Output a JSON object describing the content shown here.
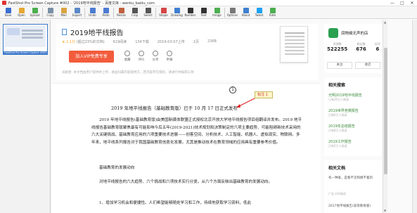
{
  "titlebar": {
    "title": "FastShot Pro Screen Capture #002 - '2019地平线报告' - 百度文库 - wenku_baidu_com",
    "minimize": "—",
    "maximize": "□",
    "close": "✕"
  },
  "toolbar": {
    "items": [
      {
        "label": "Save",
        "icon": "save-icon",
        "color": "#3b6ecf"
      },
      {
        "label": "Open",
        "icon": "open-icon",
        "color": "#e5a832"
      },
      {
        "label": "Upload",
        "icon": "upload-icon",
        "color": "#4caf50"
      },
      {
        "label": "Copy",
        "icon": "copy-icon",
        "color": "#7a8fa6"
      },
      {
        "label": "Mail",
        "icon": "mail-icon",
        "color": "#d9a441"
      },
      {
        "label": "Export",
        "icon": "export-icon",
        "color": "#5a88c8"
      },
      {
        "label": "Undo",
        "icon": "undo-icon",
        "color": "#4b7bd0"
      },
      {
        "label": "Redo",
        "icon": "redo-icon",
        "color": "#4b7bd0"
      },
      {
        "label": "Resize",
        "icon": "resize-icon",
        "color": "#c06040"
      },
      {
        "label": "Crop",
        "icon": "crop-icon",
        "color": "#555555"
      },
      {
        "label": "Select",
        "icon": "select-icon",
        "color": "#555555"
      },
      {
        "label": "Shape",
        "icon": "shape-icon",
        "color": "#d64545"
      },
      {
        "label": "Drawing",
        "icon": "drawing-icon",
        "color": "#3f7fd1"
      },
      {
        "label": "Number",
        "icon": "number-icon",
        "color": "#333333"
      },
      {
        "label": "Text",
        "icon": "text-icon",
        "color": "#333333"
      },
      {
        "label": "Image",
        "icon": "image-icon",
        "color": "#4caf50"
      },
      {
        "label": "Options",
        "icon": "options-icon",
        "color": "#777777"
      },
      {
        "label": "About",
        "icon": "about-icon",
        "color": "#3f7fd1"
      },
      {
        "label": "Tweet",
        "icon": "tweet-icon",
        "color": "#1da1f2"
      },
      {
        "label": "Rate",
        "icon": "rate-icon",
        "color": "#4caf50"
      }
    ]
  },
  "thumbnails": {
    "items": [
      {
        "caption": "FastShot Pro Screen Capture #002 - '2019地平线报告'"
      }
    ]
  },
  "doc": {
    "title": "2019地平线报告",
    "rating": "★ 2.1分",
    "rating_note": "(超过23%的文档)",
    "views": "619阅读",
    "downloads": "134下载",
    "date": "2019-03-07上传",
    "pages": "2页",
    "size": "236B",
    "vip_button": "加入VIP免费专享",
    "actions": [
      {
        "label": "收藏",
        "icon": "favorite-icon"
      },
      {
        "label": "评价",
        "icon": "rate-icon"
      },
      {
        "label": "分享",
        "icon": "share-icon"
      },
      {
        "label": "举报",
        "icon": "report-icon"
      }
    ],
    "tip": "贡献者: 本文档由用户提供并上传，收益归属内容提供方，若内容存在侵权，请进行举报或认领"
  },
  "annotation": {
    "marker": "1",
    "callout": "标注 1"
  },
  "content": {
    "heading": "2019 年地平线报告（基础教育版）已于 10 月 17 日正式发布",
    "p1": "2019 年地平线报告(基础教育版)由美国新媒体联盟正式授权北京开放大学地平线报告项目组翻译并发布。2019 地平线报告基础教育版聚焦最有可能影响今后五年(2019-2021)技术规划和决策制定的六项主要趋势、可能阻碍新技术采用的六大关键挑战、基础教育应用的六项重要技术进展——创客空间、分析技术、人工智能、机器人、虚拟现实、物联网。多年来，地平线系列报告对于我国基础教育信息化发展，尤其是推动技术在教育领域的应用具有重要参考价值。",
    "p2": "基础教育的发展动向",
    "p3": "对地平线报告的六大趋势、六个挑战和六项技术实行分类，从六个方面反映出基础教育的发展动向。",
    "p4": "1、增加学习机会和便捷性。人们希望能够随处学习和工作，持续地获取学习资料，低此"
  },
  "sidebar": {
    "shop": {
      "name": "润物细无声的店",
      "stats": [
        {
          "label": "资源数",
          "value": "522255"
        },
        {
          "label": "粉丝数",
          "value": "676"
        },
        {
          "label": "好评",
          "value": "6"
        }
      ],
      "follow": "关注",
      "visit": "进店"
    },
    "related_title": "相关搜索",
    "related": [
      {
        "title": "光明2019地平线报告",
        "meta": "已有20万人阅读"
      },
      {
        "title": "2019世界竞赛报告",
        "meta": "已有6万人阅读"
      },
      {
        "title": "2019年总结报告",
        "meta": "已有8万人阅读"
      },
      {
        "title": "2019工作报告",
        "meta": "已有5万人阅读"
      }
    ],
    "reldoc_title": "相关文档",
    "reldoc_item": "有一种爱，是看不见和摸不着的",
    "reldoc_meta": "广告    234阅读",
    "reldoc_item2": "2017地平线报告(高等教育版)"
  }
}
